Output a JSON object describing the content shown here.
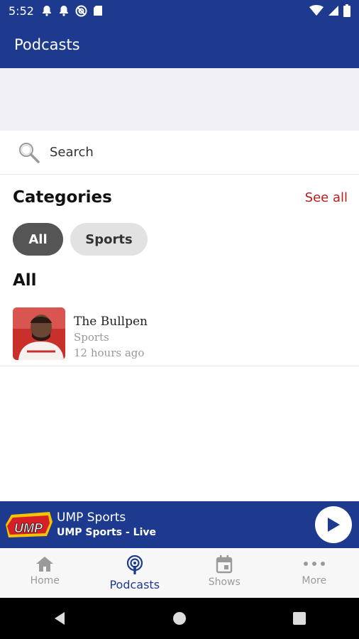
{
  "status_bar": {
    "time": "5:52",
    "left_icons": [
      "notification-bell-icon",
      "notification-bell-icon",
      "do-not-disturb-icon",
      "sd-card-icon"
    ],
    "right_icons": [
      "wifi-icon",
      "cellular-signal-icon",
      "battery-icon"
    ]
  },
  "app_bar": {
    "title": "Podcasts"
  },
  "search": {
    "label": "Search"
  },
  "categories": {
    "title": "Categories",
    "see_all": "See all",
    "chips": [
      {
        "label": "All",
        "selected": true
      },
      {
        "label": "Sports",
        "selected": false
      }
    ]
  },
  "section": {
    "title": "All"
  },
  "podcasts": [
    {
      "title": "The Bullpen",
      "category": "Sports",
      "updated": "12 hours ago"
    }
  ],
  "player": {
    "logo_text": "UMP",
    "title": "UMP Sports",
    "subtitle": "UMP Sports - Live"
  },
  "bottom_nav": [
    {
      "label": "Home",
      "icon": "home-icon",
      "active": false
    },
    {
      "label": "Podcasts",
      "icon": "podcast-icon",
      "active": true
    },
    {
      "label": "Shows",
      "icon": "calendar-icon",
      "active": false
    },
    {
      "label": "More",
      "icon": "more-dots-icon",
      "active": false
    }
  ],
  "colors": {
    "brand_blue": "#1d3a8f",
    "accent_red": "#b71c1c",
    "chip_selected": "#555555",
    "chip_unselected": "#e2e2e2"
  }
}
